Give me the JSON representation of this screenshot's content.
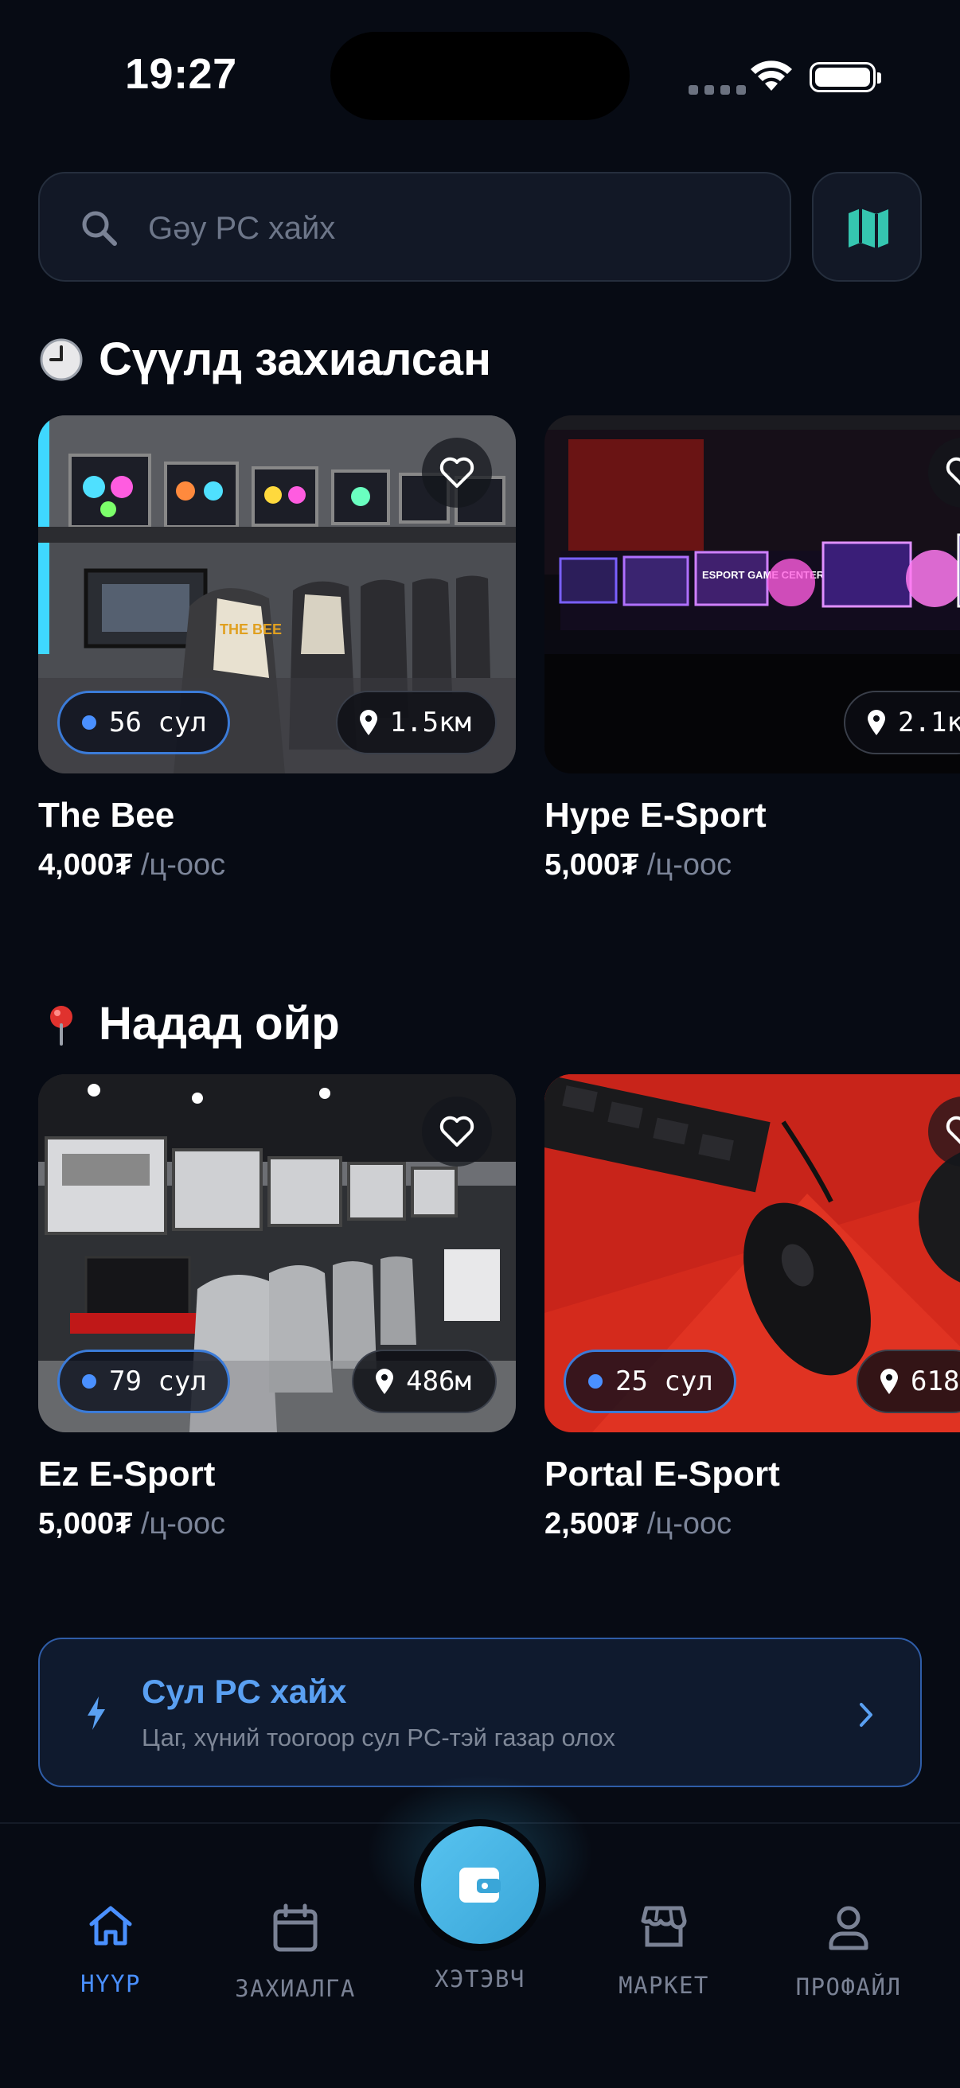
{
  "status_bar": {
    "time": "19:27"
  },
  "search": {
    "placeholder": "Gəy PC хайх"
  },
  "sections": [
    {
      "title": "Сүүлд захиалсан",
      "icon": "clock-emoji-icon",
      "cards": [
        {
          "name": "The Bee",
          "price": "4,000₮",
          "unit": "/ц-оос",
          "free": "56 сул",
          "distance": "1.5км"
        },
        {
          "name": "Hype E-Sport",
          "price": "5,000₮",
          "unit": "/ц-оос",
          "free": "",
          "distance": "2.1к"
        }
      ]
    },
    {
      "title": "Надад ойр",
      "icon": "pin-emoji-icon",
      "cards": [
        {
          "name": "Ez E-Sport",
          "price": "5,000₮",
          "unit": "/ц-оос",
          "free": "79 сул",
          "distance": "486м"
        },
        {
          "name": "Portal E-Sport",
          "price": "2,500₮",
          "unit": "/ц-оос",
          "free": "25 сул",
          "distance": "618"
        }
      ]
    }
  ],
  "banner": {
    "title": "Сул PC хайх",
    "subtitle": "Цаг, хүний тоогоор сул PC-тэй газар олох"
  },
  "tabs": [
    {
      "label": "НҮҮР",
      "icon": "home-icon",
      "active": true
    },
    {
      "label": "ЗАХИАЛГА",
      "icon": "calendar-icon",
      "active": false
    },
    {
      "label": "ХЭТЭВЧ",
      "icon": "wallet-icon",
      "active": false
    },
    {
      "label": "МАРКЕТ",
      "icon": "store-icon",
      "active": false
    },
    {
      "label": "ПРОФАЙЛ",
      "icon": "user-icon",
      "active": false
    }
  ],
  "colors": {
    "background": "#070b14",
    "accent": "#4a90ff",
    "map_accent": "#35c6b0",
    "wallet": "#4bb8e8"
  }
}
